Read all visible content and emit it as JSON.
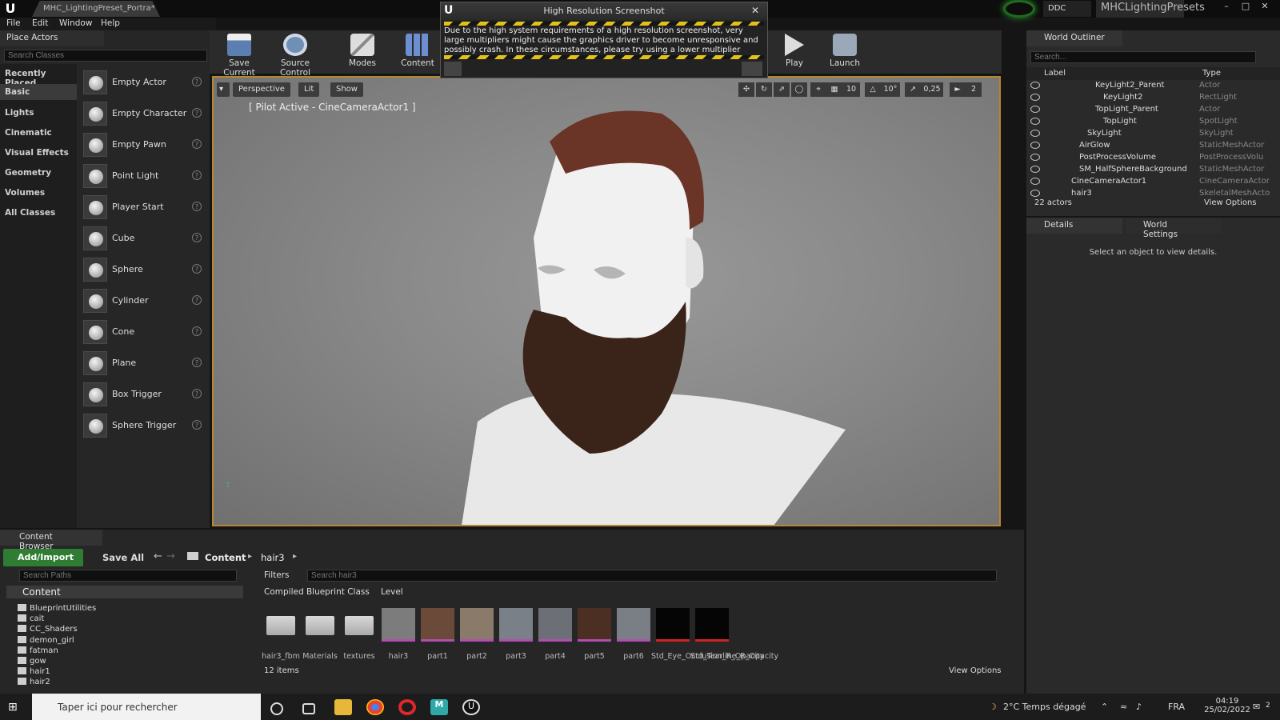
{
  "window": {
    "doc_tab": "MHC_LightingPreset_Portra*",
    "ddc": "DDC",
    "project": "MHCLightingPresets",
    "menus": [
      "File",
      "Edit",
      "Window",
      "Help"
    ]
  },
  "place_actors": {
    "tab": "Place Actors",
    "search_placeholder": "Search Classes",
    "categories": [
      "Recently Placed",
      "Basic",
      "Lights",
      "Cinematic",
      "Visual Effects",
      "Geometry",
      "Volumes",
      "All Classes"
    ],
    "actors": [
      "Empty Actor",
      "Empty Character",
      "Empty Pawn",
      "Point Light",
      "Player Start",
      "Cube",
      "Sphere",
      "Cylinder",
      "Cone",
      "Plane",
      "Box Trigger",
      "Sphere Trigger"
    ]
  },
  "toolbar": {
    "save": "Save Current",
    "source": "Source Control",
    "modes": "Modes",
    "content": "Content",
    "play": "Play",
    "launch": "Launch"
  },
  "popup": {
    "title": "High Resolution Screenshot",
    "message": "Due to the high system requirements of a high resolution screenshot, very large multipliers might cause the graphics driver to become unresponsive and possibly crash. In these circumstances, please try using a lower multiplier"
  },
  "viewport": {
    "perspective": "Perspective",
    "lit": "Lit",
    "show": "Show",
    "pilot": "[ Pilot Active - CineCameraActor1 ]",
    "grid": "10",
    "rot": "10°",
    "scale": "0,25",
    "speed": "2"
  },
  "outliner": {
    "tab": "World Outliner",
    "search_placeholder": "Search...",
    "col_label": "Label",
    "col_type": "Type",
    "rows": [
      {
        "name": "KeyLight2_Parent",
        "type": "Actor"
      },
      {
        "name": "KeyLight2",
        "type": "RectLight"
      },
      {
        "name": "TopLight_Parent",
        "type": "Actor"
      },
      {
        "name": "TopLight",
        "type": "SpotLight"
      },
      {
        "name": "SkyLight",
        "type": "SkyLight"
      },
      {
        "name": "AirGlow",
        "type": "StaticMeshActor"
      },
      {
        "name": "PostProcessVolume",
        "type": "PostProcessVolu"
      },
      {
        "name": "SM_HalfSphereBackground",
        "type": "StaticMeshActor"
      },
      {
        "name": "CineCameraActor1",
        "type": "CineCameraActor"
      },
      {
        "name": "hair3",
        "type": "SkeletalMeshActo"
      }
    ],
    "count": "22 actors",
    "view_options": "View Options"
  },
  "details": {
    "tab_details": "Details",
    "tab_world": "World Settings",
    "empty": "Select an object to view details."
  },
  "content_browser": {
    "tab": "Content Browser",
    "add_import": "Add/Import",
    "save_all": "Save All",
    "crumb_content": "Content",
    "crumb_folder": "hair3",
    "search_paths": "Search Paths",
    "filters": "Filters",
    "search_assets": "Search hair3",
    "filter_chips": [
      "Compiled Blueprint Class",
      "Level"
    ],
    "tree_root": "Content",
    "tree": [
      "BlueprintUtilities",
      "cait",
      "CC_Shaders",
      "demon_girl",
      "fatman",
      "gow",
      "hair1",
      "hair2"
    ],
    "folders": [
      "hair3_fbm",
      "Materials",
      "textures"
    ],
    "assets": [
      "hair3",
      "part1",
      "part2",
      "part3",
      "part4",
      "part5",
      "part6",
      "Std_Eye_Occlusion_R_Opacity",
      "Std_Tearline_R_Opacity"
    ],
    "item_count": "12 items",
    "view_options": "View Options"
  },
  "taskbar": {
    "search": "Taper ici pour rechercher",
    "weather": "2°C  Temps dégagé",
    "lang": "FRA",
    "time": "04:19",
    "date": "25/02/2022",
    "notif": "2"
  }
}
